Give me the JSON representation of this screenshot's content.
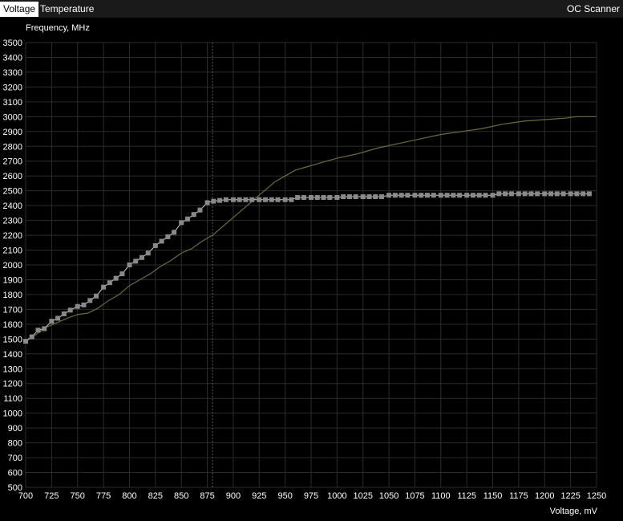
{
  "tabs": [
    {
      "label": "Voltage",
      "active": true
    },
    {
      "label": "Temperature",
      "active": false
    }
  ],
  "oc_scanner_label": "OC Scanner",
  "chart_data": {
    "type": "line",
    "ylabel": "Frequency, MHz",
    "xlabel": "Voltage, mV",
    "xlim": [
      700,
      1250
    ],
    "ylim": [
      500,
      3500
    ],
    "x_ticks": [
      700,
      725,
      750,
      775,
      800,
      825,
      850,
      875,
      900,
      925,
      950,
      975,
      1000,
      1025,
      1050,
      1075,
      1100,
      1125,
      1150,
      1175,
      1200,
      1225,
      1250
    ],
    "y_ticks": [
      500,
      600,
      700,
      800,
      900,
      1000,
      1100,
      1200,
      1300,
      1400,
      1500,
      1600,
      1700,
      1800,
      1900,
      2000,
      2100,
      2200,
      2300,
      2400,
      2500,
      2600,
      2700,
      2800,
      2900,
      3000,
      3100,
      3200,
      3300,
      3400,
      3500
    ],
    "current_voltage_marker": 880,
    "grid": true,
    "colors": {
      "curve": "#cfcfcf",
      "points": "#8a8a8a",
      "default_curve": "#6e6a3c",
      "grid": "#2c2c2c"
    },
    "series": [
      {
        "x": [
          700,
          706,
          712,
          718,
          725,
          731,
          737,
          743,
          750,
          756,
          762,
          768,
          775,
          781,
          787,
          793,
          800,
          806,
          812,
          818,
          825,
          831,
          837,
          843,
          850,
          856,
          862,
          868,
          875,
          881,
          887,
          893,
          900,
          906,
          912,
          918,
          925,
          931,
          937,
          943,
          950,
          956,
          962,
          968,
          975,
          981,
          987,
          993,
          1000,
          1006,
          1012,
          1018,
          1025,
          1031,
          1037,
          1043,
          1050,
          1056,
          1062,
          1068,
          1075,
          1081,
          1087,
          1093,
          1100,
          1106,
          1112,
          1118,
          1125,
          1131,
          1137,
          1143,
          1150,
          1156,
          1162,
          1168,
          1175,
          1181,
          1187,
          1193,
          1200,
          1206,
          1212,
          1218,
          1225,
          1231,
          1237,
          1243
        ],
        "y": [
          1485,
          1515,
          1560,
          1570,
          1620,
          1640,
          1670,
          1695,
          1720,
          1730,
          1760,
          1790,
          1850,
          1880,
          1910,
          1940,
          2000,
          2025,
          2050,
          2080,
          2130,
          2160,
          2190,
          2220,
          2285,
          2310,
          2340,
          2370,
          2420,
          2430,
          2435,
          2440,
          2440,
          2440,
          2440,
          2440,
          2440,
          2440,
          2440,
          2440,
          2440,
          2440,
          2455,
          2455,
          2455,
          2455,
          2455,
          2455,
          2455,
          2460,
          2460,
          2460,
          2460,
          2460,
          2460,
          2460,
          2470,
          2470,
          2470,
          2470,
          2470,
          2470,
          2470,
          2470,
          2470,
          2470,
          2470,
          2470,
          2470,
          2470,
          2470,
          2470,
          2470,
          2480,
          2480,
          2480,
          2480,
          2480,
          2480,
          2480,
          2480,
          2480,
          2480,
          2480,
          2480,
          2480,
          2480,
          2480
        ]
      },
      {
        "x": [
          700,
          710,
          720,
          730,
          740,
          750,
          760,
          770,
          780,
          790,
          800,
          810,
          820,
          830,
          840,
          850,
          860,
          870,
          880,
          890,
          900,
          910,
          920,
          930,
          940,
          950,
          960,
          970,
          980,
          990,
          1000,
          1020,
          1040,
          1060,
          1080,
          1100,
          1120,
          1140,
          1160,
          1180,
          1200,
          1220,
          1230,
          1250
        ],
        "y": [
          1490,
          1530,
          1580,
          1610,
          1640,
          1665,
          1675,
          1710,
          1760,
          1800,
          1860,
          1900,
          1940,
          1990,
          2030,
          2080,
          2110,
          2160,
          2200,
          2260,
          2320,
          2380,
          2440,
          2500,
          2560,
          2600,
          2640,
          2660,
          2680,
          2700,
          2720,
          2750,
          2790,
          2820,
          2850,
          2880,
          2900,
          2920,
          2950,
          2970,
          2980,
          2990,
          3000,
          3000
        ]
      }
    ]
  }
}
